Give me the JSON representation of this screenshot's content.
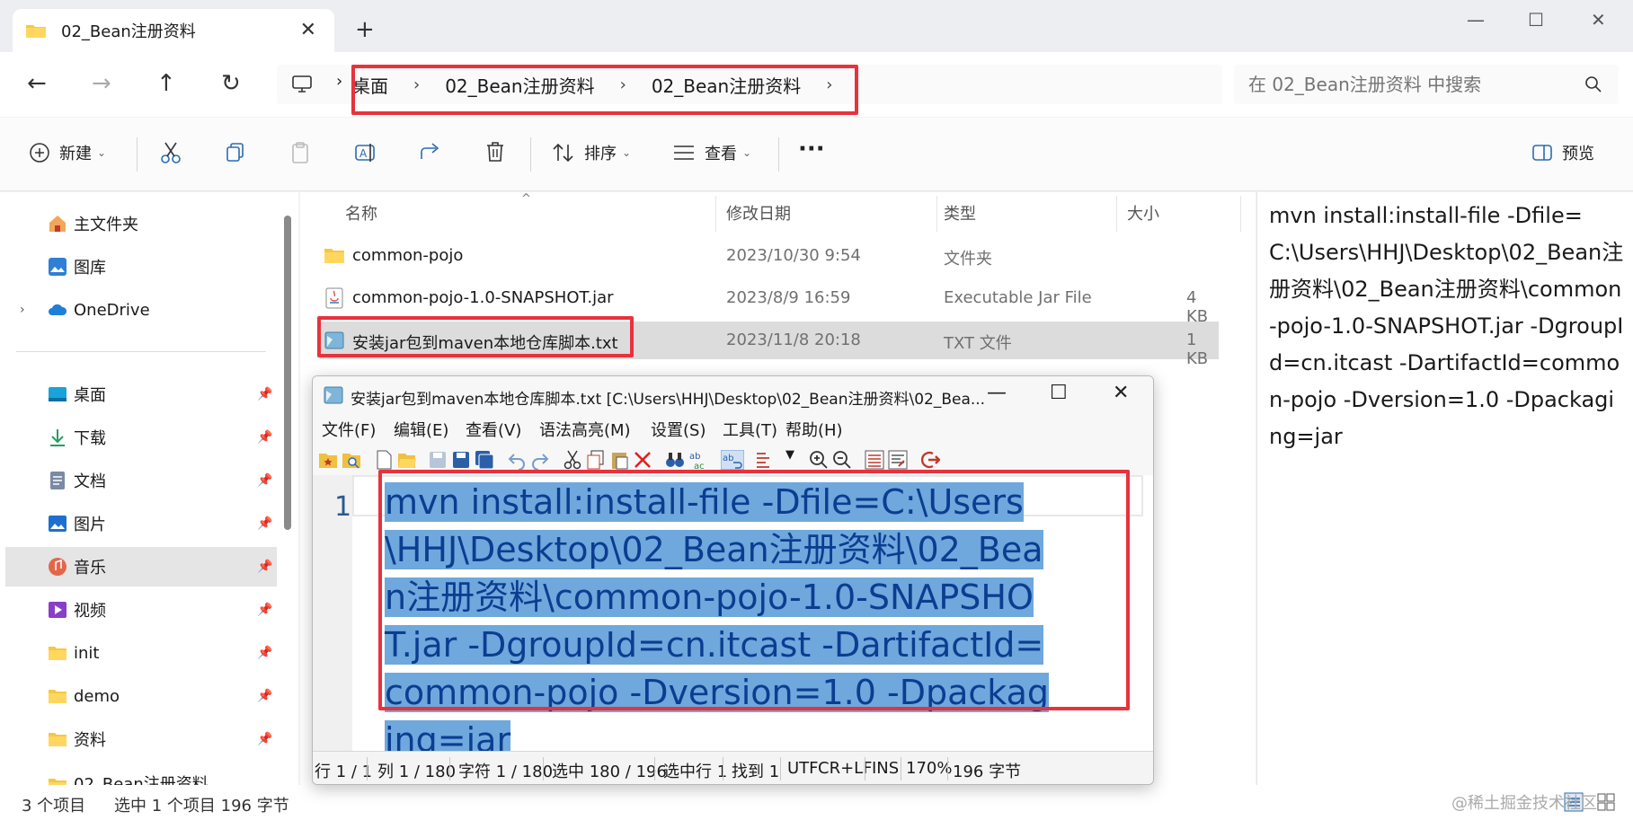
{
  "tab": {
    "title": "02_Bean注册资料",
    "close": "✕",
    "new": "+"
  },
  "window_controls": {
    "min": "—",
    "max": "☐",
    "close": "✕"
  },
  "nav": {
    "back": "←",
    "forward": "→",
    "up": "↑",
    "refresh": "↻"
  },
  "breadcrumb": [
    "桌面",
    "02_Bean注册资料",
    "02_Bean注册资料"
  ],
  "breadcrumb_sep": "›",
  "search": {
    "placeholder": "在 02_Bean注册资料 中搜索"
  },
  "commandbar": {
    "new": "新建",
    "sort": "排序",
    "view": "查看",
    "more": "···",
    "preview": "预览"
  },
  "sidebar": {
    "top": [
      {
        "label": "主文件夹",
        "icon": "home-icon"
      },
      {
        "label": "图库",
        "icon": "gallery-icon"
      },
      {
        "label": "OneDrive",
        "icon": "cloud-icon"
      }
    ],
    "pinned": [
      {
        "label": "桌面",
        "icon": "desktop-icon"
      },
      {
        "label": "下载",
        "icon": "download-icon"
      },
      {
        "label": "文档",
        "icon": "document-icon"
      },
      {
        "label": "图片",
        "icon": "picture-icon"
      },
      {
        "label": "音乐",
        "icon": "music-icon"
      },
      {
        "label": "视频",
        "icon": "video-icon"
      },
      {
        "label": "init",
        "icon": "folder-icon"
      },
      {
        "label": "demo",
        "icon": "folder-icon"
      },
      {
        "label": "资料",
        "icon": "folder-icon"
      },
      {
        "label": "02_Bean注册资料",
        "icon": "folder-icon"
      }
    ]
  },
  "columns": {
    "name": "名称",
    "date": "修改日期",
    "type": "类型",
    "size": "大小"
  },
  "files": [
    {
      "name": "common-pojo",
      "date": "2023/10/30 9:54",
      "type": "文件夹",
      "size": ""
    },
    {
      "name": "common-pojo-1.0-SNAPSHOT.jar",
      "date": "2023/8/9 16:59",
      "type": "Executable Jar File",
      "size": "4 KB"
    },
    {
      "name": "安装jar包到maven本地仓库脚本.txt",
      "date": "2023/11/8 20:18",
      "type": "TXT 文件",
      "size": "1 KB"
    }
  ],
  "preview_text": "mvn install:install-file -Dfile=C:\\Users\\HHJ\\Desktop\\02_Bean注册资料\\02_Bean注册资料\\common-pojo-1.0-SNAPSHOT.jar -DgroupId=cn.itcast -DartifactId=common-pojo -Dversion=1.0 -Dpackaging=jar",
  "status": {
    "count": "3 个项目",
    "selected": "选中 1 个项目 196 字节"
  },
  "watermark": "@稀土掘金技术社区",
  "notepad": {
    "title": "安装jar包到maven本地仓库脚本.txt [C:\\Users\\HHJ\\Desktop\\02_Bean注册资料\\02_Bea...",
    "menu": [
      "文件(F)",
      "编辑(E)",
      "查看(V)",
      "语法高亮(M)",
      "设置(S)",
      "工具(T)",
      "帮助(H)"
    ],
    "line_number": "1",
    "code": "mvn install:install-file -Dfile=C:\\Users\\HHJ\\Desktop\\02_Bean注册资料\\02_Bean注册资料\\common-pojo-1.0-SNAPSHOT.jar -DgroupId=cn.itcast -DartifactId=common-pojo -Dversion=1.0 -Dpackaging=jar",
    "status": [
      "行 1 / 1",
      "列 1 / 180",
      "字符 1 / 180",
      "选中 180 / 196",
      "选中行 1",
      "找到 1",
      "UTF",
      "CR+LF",
      "INS",
      "170%",
      "196 字节"
    ]
  },
  "colors": {
    "highlight": "#e8323c",
    "selection": "#6fa8dc",
    "code_text": "#0b3d91"
  }
}
